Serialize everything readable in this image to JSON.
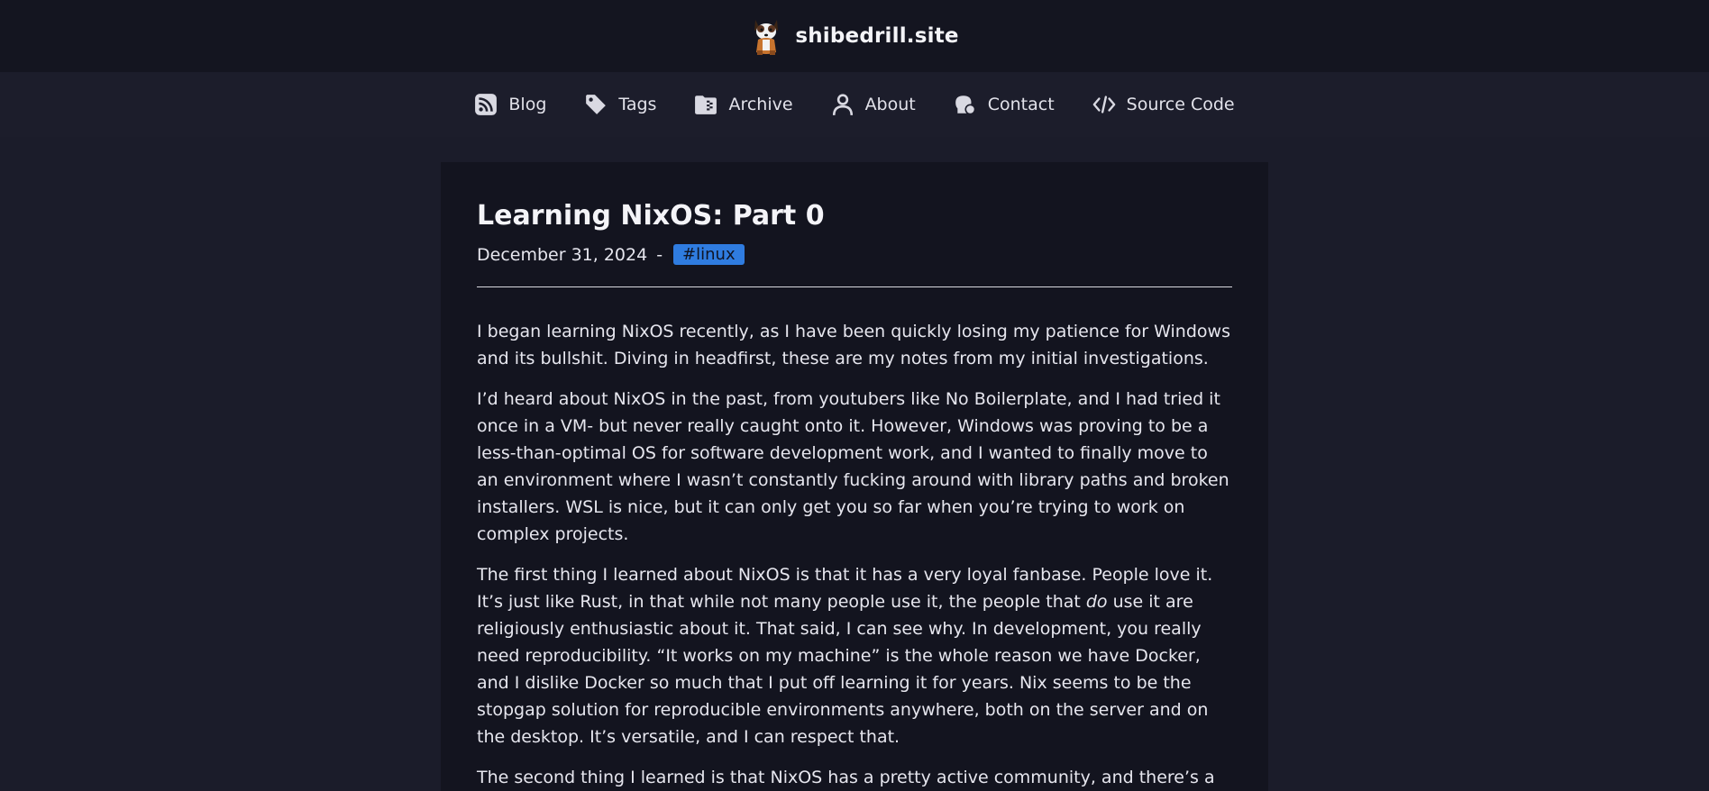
{
  "site": {
    "name": "shibedrill.site",
    "logo_icon": "shiba-dog-logo"
  },
  "nav": {
    "items": [
      {
        "label": "Blog",
        "icon": "rss-icon"
      },
      {
        "label": "Tags",
        "icon": "tag-icon"
      },
      {
        "label": "Archive",
        "icon": "archive-icon"
      },
      {
        "label": "About",
        "icon": "user-icon"
      },
      {
        "label": "Contact",
        "icon": "contact-icon"
      },
      {
        "label": "Source Code",
        "icon": "code-icon"
      }
    ]
  },
  "post": {
    "title": "Learning NixOS: Part 0",
    "date": "December 31, 2024",
    "separator": "-",
    "tag": "#linux",
    "paragraphs": {
      "p1": "I began learning NixOS recently, as I have been quickly losing my patience for Windows and its bullshit. Diving in headfirst, these are my notes from my initial investigations.",
      "p2": "I’d heard about NixOS in the past, from youtubers like No Boilerplate, and I had tried it once in a VM- but never really caught onto it. However, Windows was proving to be a less-than-optimal OS for software development work, and I wanted to finally move to an environment where I wasn’t constantly fucking around with library paths and broken installers. WSL is nice, but it can only get you so far when you’re trying to work on complex projects.",
      "p3_before": "The first thing I learned about NixOS is that it has a very loyal fanbase. People love it. It’s just like Rust, in that while not many people use it, the people that ",
      "p3_em": "do",
      "p3_after": " use it are religiously enthusiastic about it. That said, I can see why. In development, you really need reproducibility. “It works on my machine” is the whole reason we have Docker, and I dislike Docker so much that I put off learning it for years. Nix seems to be the stopgap solution for reproducible environments anywhere, both on the server and on the desktop. It’s versatile, and I can respect that.",
      "p4": "The second thing I learned is that NixOS has a pretty active community, and there’s a lot"
    }
  },
  "colors": {
    "header_bg": "#141520",
    "nav_bg": "#1c1d2b",
    "page_bg": "#1b1c2a",
    "card_bg": "#13141f",
    "tag_bg": "#2f7ce0",
    "text": "#e6e6ee"
  }
}
